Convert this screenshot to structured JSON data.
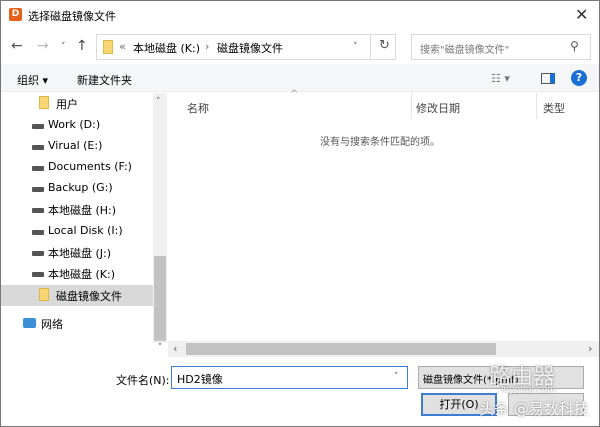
{
  "title": "选择磁盘镜像文件",
  "address": {
    "prefix": "«",
    "path": [
      "本地磁盘 (K:)",
      "磁盘镜像文件"
    ],
    "separator": "›"
  },
  "search": {
    "placeholder": "搜索\"磁盘镜像文件\""
  },
  "toolbar": {
    "organize": "组织 ▾",
    "new_folder": "新建文件夹",
    "help": "?"
  },
  "nav_items": [
    {
      "label": "用户",
      "icon": "folder"
    },
    {
      "label": "Work (D:)",
      "icon": "drive"
    },
    {
      "label": "Virual (E:)",
      "icon": "drive"
    },
    {
      "label": "Documents (F:)",
      "icon": "drive"
    },
    {
      "label": "Backup (G:)",
      "icon": "drive"
    },
    {
      "label": "本地磁盘 (H:)",
      "icon": "drive"
    },
    {
      "label": "Local Disk (I:)",
      "icon": "drive"
    },
    {
      "label": "本地磁盘 (J:)",
      "icon": "drive"
    },
    {
      "label": "本地磁盘 (K:)",
      "icon": "drive"
    },
    {
      "label": "磁盘镜像文件",
      "icon": "folder",
      "selected": true
    },
    {
      "label": "网络",
      "icon": "network"
    }
  ],
  "columns": {
    "name": "名称",
    "modified": "修改日期",
    "type": "类型"
  },
  "empty_message": "没有与搜索条件匹配的项。",
  "filename": {
    "label": "文件名(N):",
    "value": "HD2镜像"
  },
  "filetype": {
    "value": "磁盘镜像文件(*.pmf)"
  },
  "buttons": {
    "open": "打开(O)"
  },
  "watermark": {
    "site": "路由器",
    "url": "luyouqi.com",
    "credit": "头条 @易数科技"
  }
}
